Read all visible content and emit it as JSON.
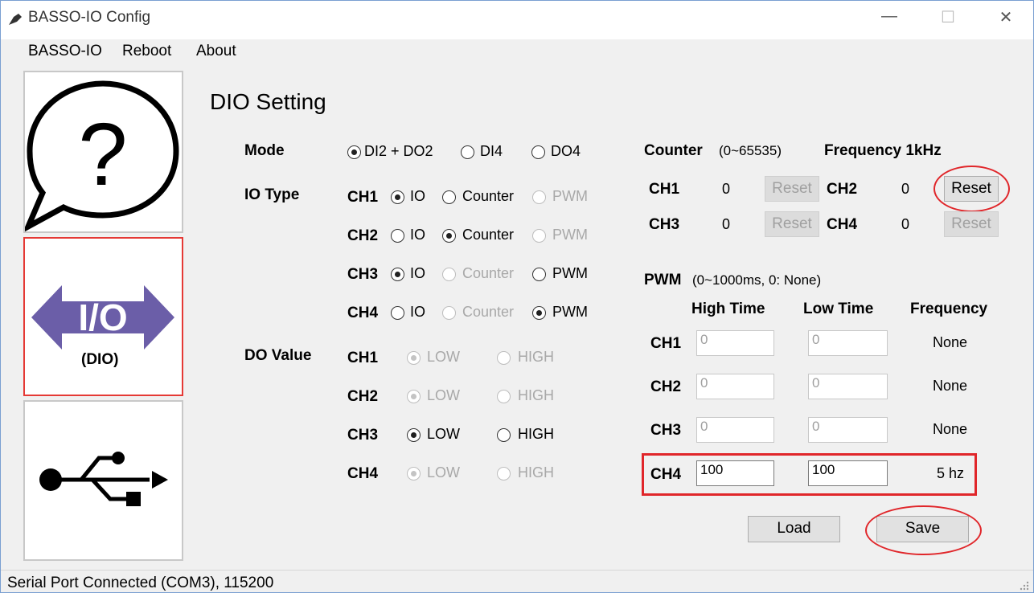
{
  "window": {
    "title": "BASSO-IO Config",
    "minimize": "—",
    "maximize": "☐",
    "close": "✕"
  },
  "menu": [
    "BASSO-IO",
    "Reboot",
    "About"
  ],
  "sidebar": {
    "help_symbol": "?",
    "io_label": "I/O",
    "dio_label": "(DIO)"
  },
  "page_title": "DIO Setting",
  "mode": {
    "label": "Mode",
    "options": [
      {
        "label": "DI2 + DO2",
        "checked": true
      },
      {
        "label": "DI4",
        "checked": false
      },
      {
        "label": "DO4",
        "checked": false
      }
    ]
  },
  "io_type": {
    "label": "IO Type",
    "channels": [
      {
        "ch": "CH1",
        "io": "IO",
        "counter": "Counter",
        "pwm": "PWM",
        "selected": "io"
      },
      {
        "ch": "CH2",
        "io": "IO",
        "counter": "Counter",
        "pwm": "PWM",
        "selected": "counter"
      },
      {
        "ch": "CH3",
        "io": "IO",
        "counter": "Counter",
        "pwm": "PWM",
        "selected": "io"
      },
      {
        "ch": "CH4",
        "io": "IO",
        "counter": "Counter",
        "pwm": "PWM",
        "selected": "pwm"
      }
    ]
  },
  "do_value": {
    "label": "DO Value",
    "channels": [
      {
        "ch": "CH1",
        "low": "LOW",
        "high": "HIGH",
        "selected": "low",
        "enabled": false
      },
      {
        "ch": "CH2",
        "low": "LOW",
        "high": "HIGH",
        "selected": "low",
        "enabled": false
      },
      {
        "ch": "CH3",
        "low": "LOW",
        "high": "HIGH",
        "selected": "low",
        "enabled": true
      },
      {
        "ch": "CH4",
        "low": "LOW",
        "high": "HIGH",
        "selected": "low",
        "enabled": false
      }
    ]
  },
  "counter": {
    "label": "Counter",
    "range": "(0~65535)",
    "frequency": "Frequency 1kHz",
    "reset_label": "Reset",
    "channels": [
      {
        "ch": "CH1",
        "value": "0"
      },
      {
        "ch": "CH2",
        "value": "0"
      },
      {
        "ch": "CH3",
        "value": "0"
      },
      {
        "ch": "CH4",
        "value": "0"
      }
    ]
  },
  "pwm": {
    "label": "PWM",
    "range": "(0~1000ms, 0: None)",
    "col_high": "High Time",
    "col_low": "Low Time",
    "col_freq": "Frequency",
    "channels": [
      {
        "ch": "CH1",
        "high": "0",
        "low": "0",
        "freq": "None"
      },
      {
        "ch": "CH2",
        "high": "0",
        "low": "0",
        "freq": "None"
      },
      {
        "ch": "CH3",
        "high": "0",
        "low": "0",
        "freq": "None"
      },
      {
        "ch": "CH4",
        "high": "100",
        "low": "100",
        "freq": "5 hz"
      }
    ]
  },
  "buttons": {
    "load": "Load",
    "save": "Save"
  },
  "status": "Serial Port Connected (COM3), 115200",
  "colors": {
    "accent_purple": "#6b5ea8",
    "annotation_red": "#e0262a",
    "sidebar_selected_border": "#e53935"
  }
}
